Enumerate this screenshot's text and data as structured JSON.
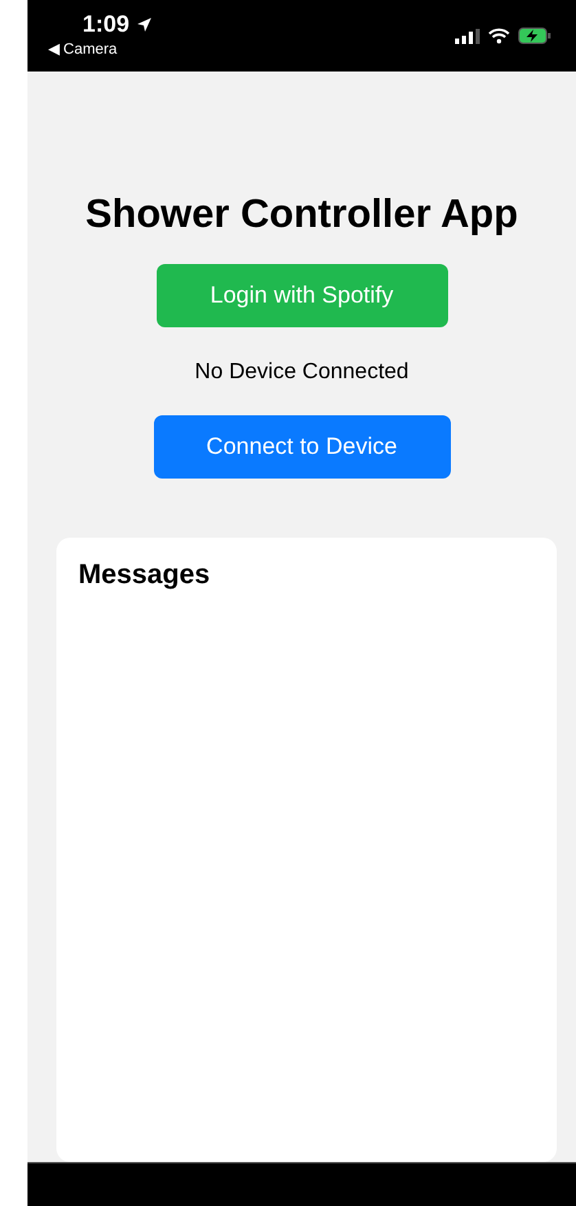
{
  "status_bar": {
    "time": "1:09",
    "back_link": "◀ Camera"
  },
  "title": "Shower Controller App",
  "login_button": "Login with Spotify",
  "device_status": "No Device Connected",
  "connect_button": "Connect to Device",
  "messages_panel": {
    "title": "Messages"
  }
}
